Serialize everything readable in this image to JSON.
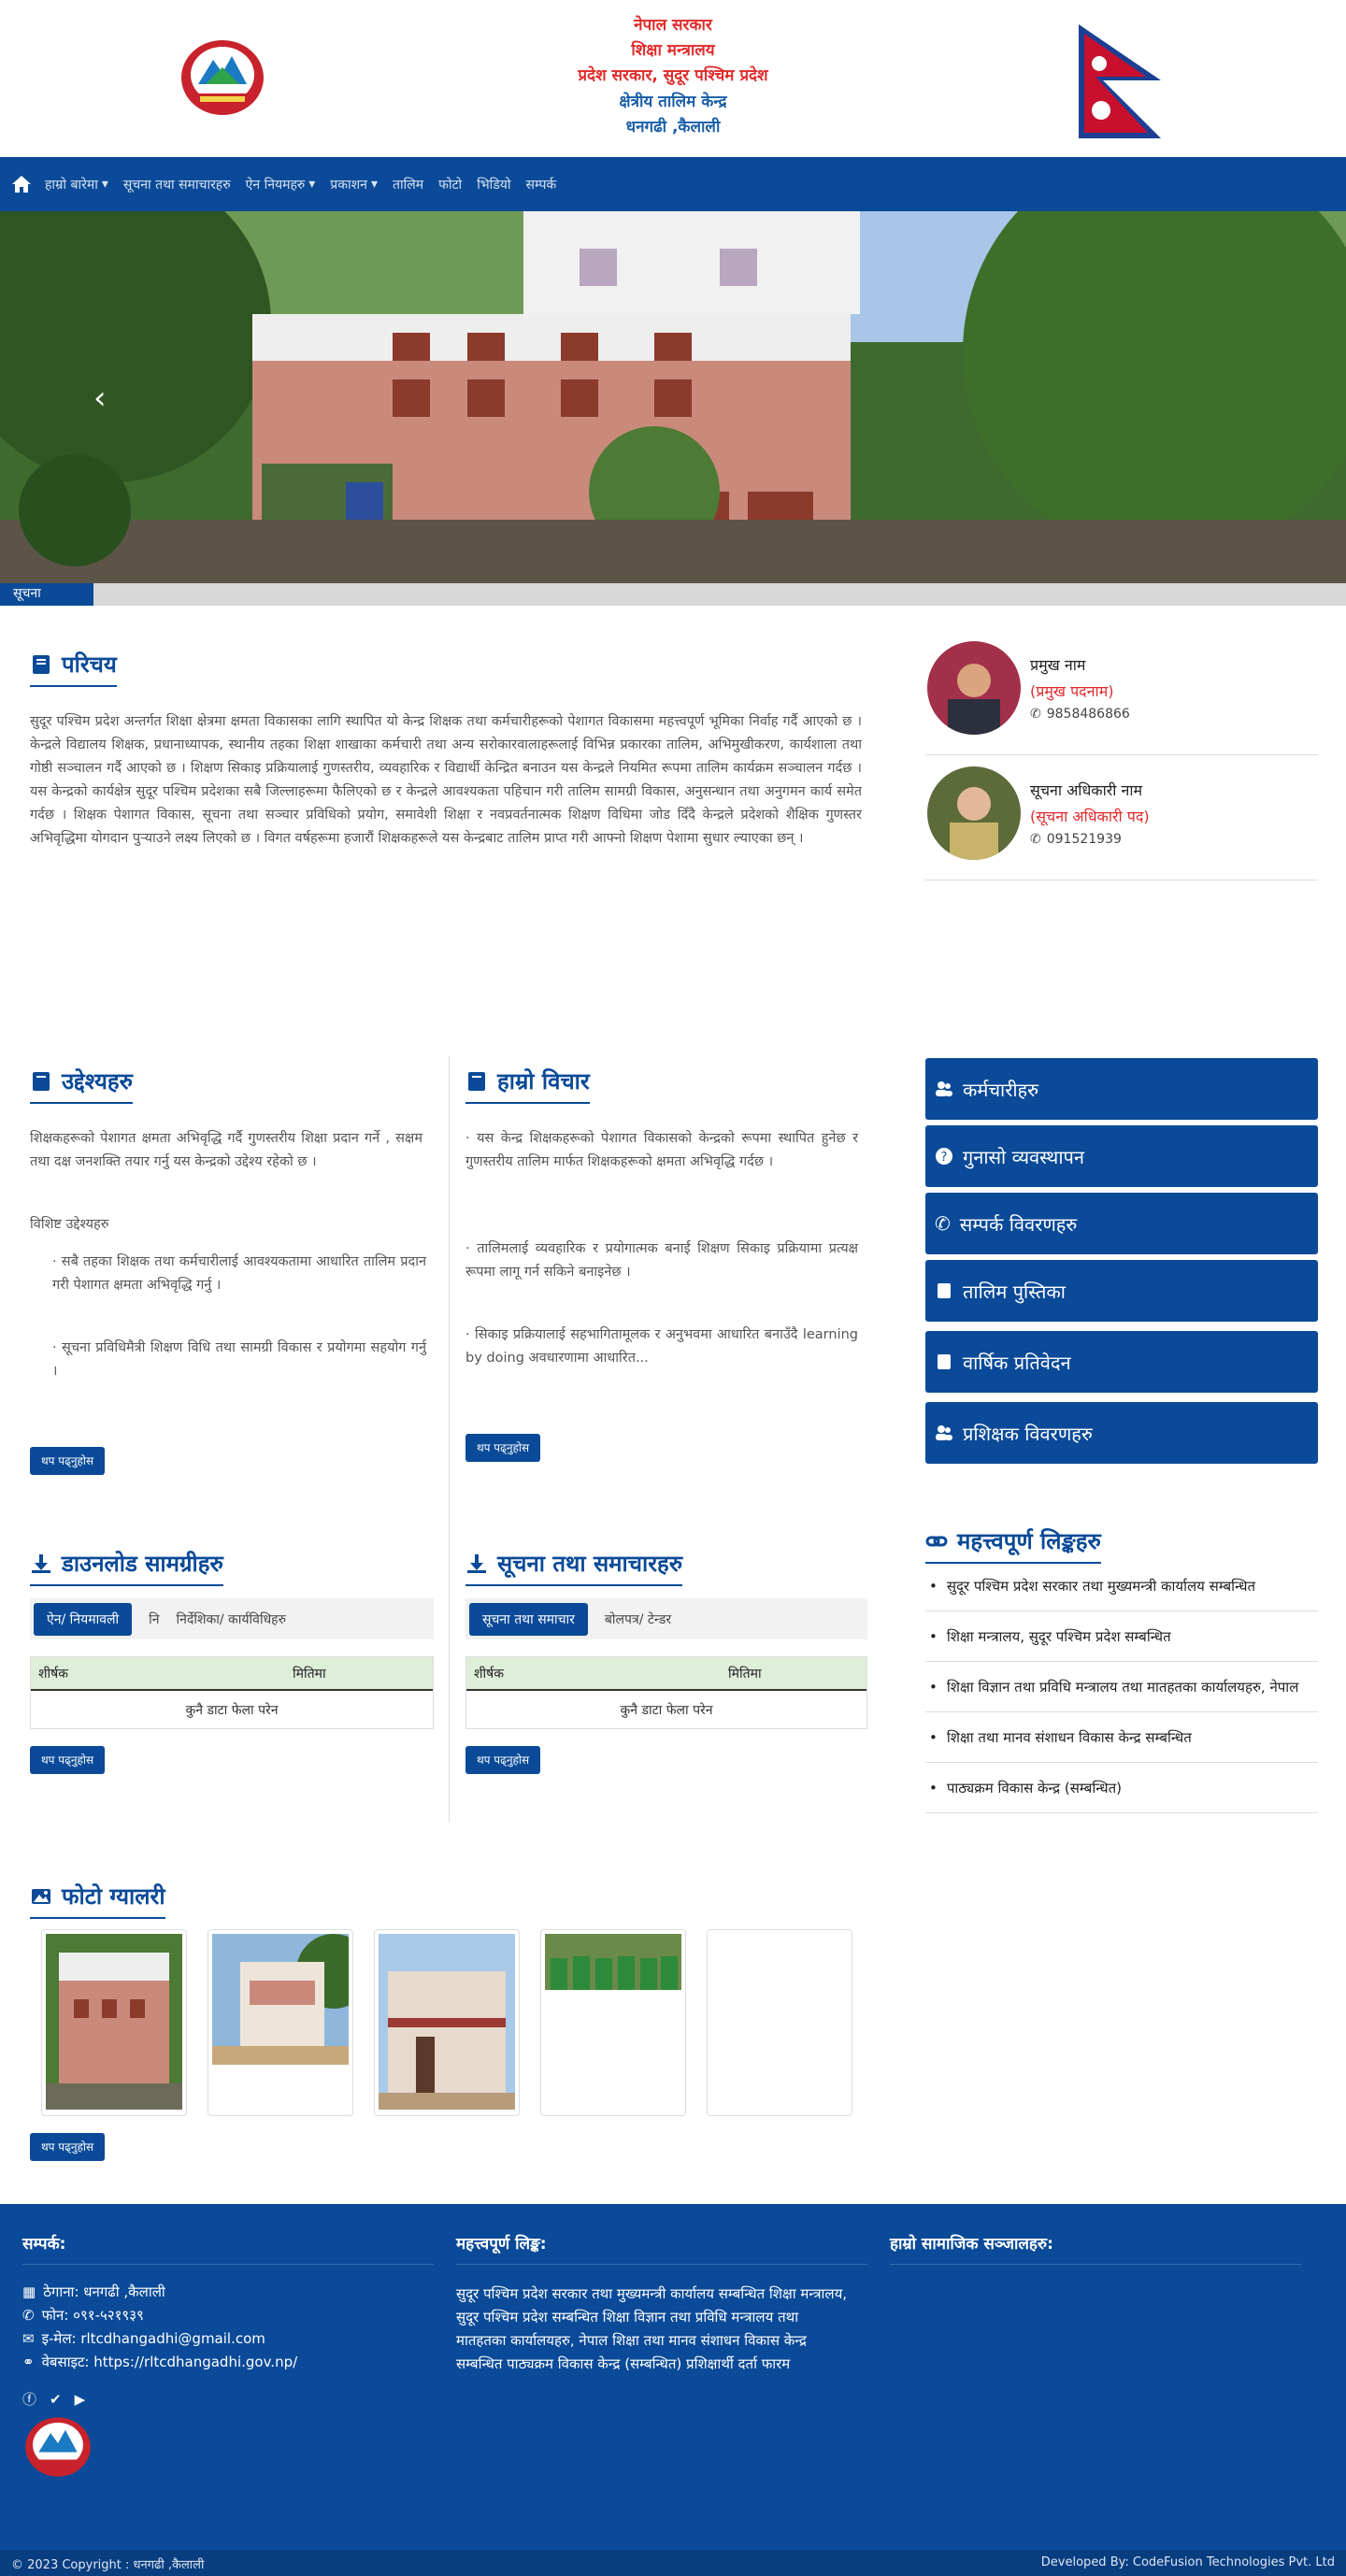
{
  "header": {
    "line1": "नेपाल सरकार",
    "line2": "शिक्षा मन्त्रालय",
    "line3": "प्रदेश सरकार, सुदूर पश्चिम प्रदेश",
    "line4": "क्षेत्रीय तालिम केन्द्र",
    "line5": "धनगढी ,कैलाली"
  },
  "nav": {
    "items": [
      {
        "label": "हाम्रो बारेमा",
        "caret": true
      },
      {
        "label": "सूचना तथा समाचारहरु",
        "caret": false
      },
      {
        "label": "ऐन नियमहरु",
        "caret": true
      },
      {
        "label": "प्रकाशन",
        "caret": true
      },
      {
        "label": "तालिम",
        "caret": false
      },
      {
        "label": "फोटो",
        "caret": false
      },
      {
        "label": "भिडियो",
        "caret": false
      },
      {
        "label": "सम्पर्क",
        "caret": false
      }
    ]
  },
  "ticker": {
    "label": "सूचना"
  },
  "intro": {
    "title": "परिचय",
    "body": "सुदूर पश्चिम प्रदेश अन्तर्गत शिक्षा क्षेत्रमा क्षमता विकासका लागि स्थापित यो केन्द्र शिक्षक तथा कर्मचारीहरूको पेशागत विकासमा महत्त्वपूर्ण भूमिका निर्वाह गर्दै आएको छ । केन्द्रले विद्यालय शिक्षक, प्रधानाध्यापक, स्थानीय तहका शिक्षा शाखाका कर्मचारी तथा अन्य सरोकारवालाहरूलाई विभिन्न प्रकारका तालिम, अभिमुखीकरण, कार्यशाला तथा गोष्ठी सञ्चालन गर्दै आएको छ । शिक्षण सिकाइ प्रक्रियालाई गुणस्तरीय, व्यवहारिक र विद्यार्थी केन्द्रित बनाउन यस केन्द्रले नियमित रूपमा तालिम कार्यक्रम सञ्चालन गर्दछ । यस केन्द्रको कार्यक्षेत्र सुदूर पश्चिम प्रदेशका सबै जिल्लाहरूमा फैलिएको छ र केन्द्रले आवश्यकता पहिचान गरी तालिम सामग्री विकास, अनुसन्धान तथा अनुगमन कार्य समेत गर्दछ । शिक्षक पेशागत विकास, सूचना तथा सञ्चार प्रविधिको प्रयोग, समावेशी शिक्षा र नवप्रवर्तनात्मक शिक्षण विधिमा जोड दिँदै केन्द्रले प्रदेशको शैक्षिक गुणस्तर अभिवृद्धिमा योगदान पुर्‍याउने लक्ष्य लिएको छ । विगत वर्षहरूमा हजारौं शिक्षकहरूले यस केन्द्रबाट तालिम प्राप्त गरी आफ्नो शिक्षण पेशामा सुधार ल्याएका छन् ।"
  },
  "officials": [
    {
      "name": "प्रमुख नाम",
      "role": "(प्रमुख पदनाम)",
      "phone": "9858486866"
    },
    {
      "name": "सूचना अधिकारी नाम",
      "role": "(सूचना अधिकारी पद)",
      "phone": "091521939"
    }
  ],
  "objectives": {
    "title": "उद्देश्यहरु",
    "intro": "शिक्षकहरूको पेशागत क्षमता अभिवृद्धि गर्दै गुणस्तरीय शिक्षा प्रदान गर्ने , सक्षम तथा दक्ष जनशक्ति तयार गर्नु यस केन्द्रको उद्देश्य रहेको छ ।",
    "subtitle": "विशिष्ट उद्देश्यहरु",
    "items": [
      "सबै तहका शिक्षक तथा कर्मचारीलाई आवश्यकतामा आधारित तालिम प्रदान गरी पेशागत क्षमता अभिवृद्धि गर्नु ।",
      "सूचना प्रविधिमैत्री शिक्षण विधि तथा सामग्री विकास र प्रयोगमा सहयोग गर्नु ।"
    ],
    "more": "थप पढ्नुहोस"
  },
  "thoughts": {
    "title": "हाम्रो विचार",
    "items": [
      "यस केन्द्र शिक्षकहरूको पेशागत विकासको केन्द्रको रूपमा स्थापित हुनेछ र गुणस्तरीय तालिम मार्फत शिक्षकहरूको क्षमता अभिवृद्धि गर्दछ ।",
      "तालिमलाई व्यवहारिक र प्रयोगात्मक बनाई शिक्षण सिकाइ प्रक्रियामा प्रत्यक्ष रूपमा लागू गर्न सकिने बनाइनेछ ।",
      "सिकाइ प्रक्रियालाई सहभागितामूलक र अनुभवमा आधारित बनाउँदै learning by doing  अवधारणामा आधारित..."
    ],
    "more": "थप पढ्नुहोस"
  },
  "side_buttons": [
    {
      "label": "कर्मचारीहरु",
      "icon": "users-icon"
    },
    {
      "label": "गुनासो व्यवस्थापन",
      "icon": "question-icon"
    },
    {
      "label": "सम्पर्क विवरणहरु",
      "icon": "phone-icon"
    },
    {
      "label": "तालिम पुस्तिका",
      "icon": "book-icon"
    },
    {
      "label": "वार्षिक प्रतिवेदन",
      "icon": "book-icon"
    },
    {
      "label": "प्रशिक्षक विवरणहरु",
      "icon": "users-icon"
    }
  ],
  "downloads": {
    "title": "डाउनलोड सामग्रीहरु",
    "tabs": [
      "ऐन/ नियमावली",
      "नि",
      "निर्देशिका/ कार्यविधिहरु"
    ],
    "cols": [
      "शीर्षक",
      "मितिमा"
    ],
    "empty": "कुनै डाटा फेला परेन",
    "more": "थप पढ्नुहोस"
  },
  "notices": {
    "title": "सूचना तथा समाचारहरु",
    "tabs": [
      "सूचना तथा समाचार",
      "बोलपत्र/ टेन्डर"
    ],
    "cols": [
      "शीर्षक",
      "मितिमा"
    ],
    "empty": "कुनै डाटा फेला परेन",
    "more": "थप पढ्नुहोस"
  },
  "links": {
    "title": "महत्त्वपूर्ण लिङ्कहरु",
    "items": [
      "सुदूर पश्चिम प्रदेश सरकार तथा मुख्यमन्त्री कार्यालय सम्बन्धित",
      "शिक्षा मन्त्रालय, सुदूर पश्चिम प्रदेश सम्बन्धित",
      "शिक्षा विज्ञान तथा प्रविधि मन्त्रालय तथा मातहतका कार्यालयहरु, नेपाल",
      "शिक्षा तथा मानव संशाधन विकास केन्द्र सम्बन्धित",
      "पाठ्यक्रम विकास केन्द्र (सम्बन्धित)"
    ]
  },
  "gallery": {
    "title": "फोटो ग्यालरी",
    "more": "थप पढ्नुहोस"
  },
  "footer": {
    "contact_title": "सम्पर्क:",
    "address": "ठेगाना: धनगढी ,कैलाली",
    "phone": "फोन: ०९१-५२१९३९",
    "email": "इ-मेल: rltcdhangadhi@gmail.com",
    "website": "वेबसाइट: https://rltcdhangadhi.gov.np/",
    "links_title": "महत्त्वपूर्ण लिङ्क:",
    "links_text": "सुदूर पश्चिम प्रदेश सरकार तथा मुख्यमन्त्री कार्यालय सम्बन्धित शिक्षा मन्त्रालय, सुदूर पश्चिम प्रदेश सम्बन्धित शिक्षा विज्ञान तथा प्रविधि मन्त्रालय तथा मातहतका कार्यालयहरु, नेपाल शिक्षा तथा मानव संशाधन विकास केन्द्र सम्बन्धित पाठ्यक्रम विकास केन्द्र (सम्बन्धित) प्रशिक्षार्थी दर्ता फारम",
    "social_title": "हाम्रो सामाजिक सञ्जालहरु:",
    "copyright": "© 2023 Copyright : धनगढी ,कैलाली",
    "developer": "Developed By: CodeFusion Technologies Pvt. Ltd"
  },
  "colors": {
    "brand": "#0a4a98",
    "accent_red": "#e02b2b",
    "table_head": "#dfeed8"
  }
}
